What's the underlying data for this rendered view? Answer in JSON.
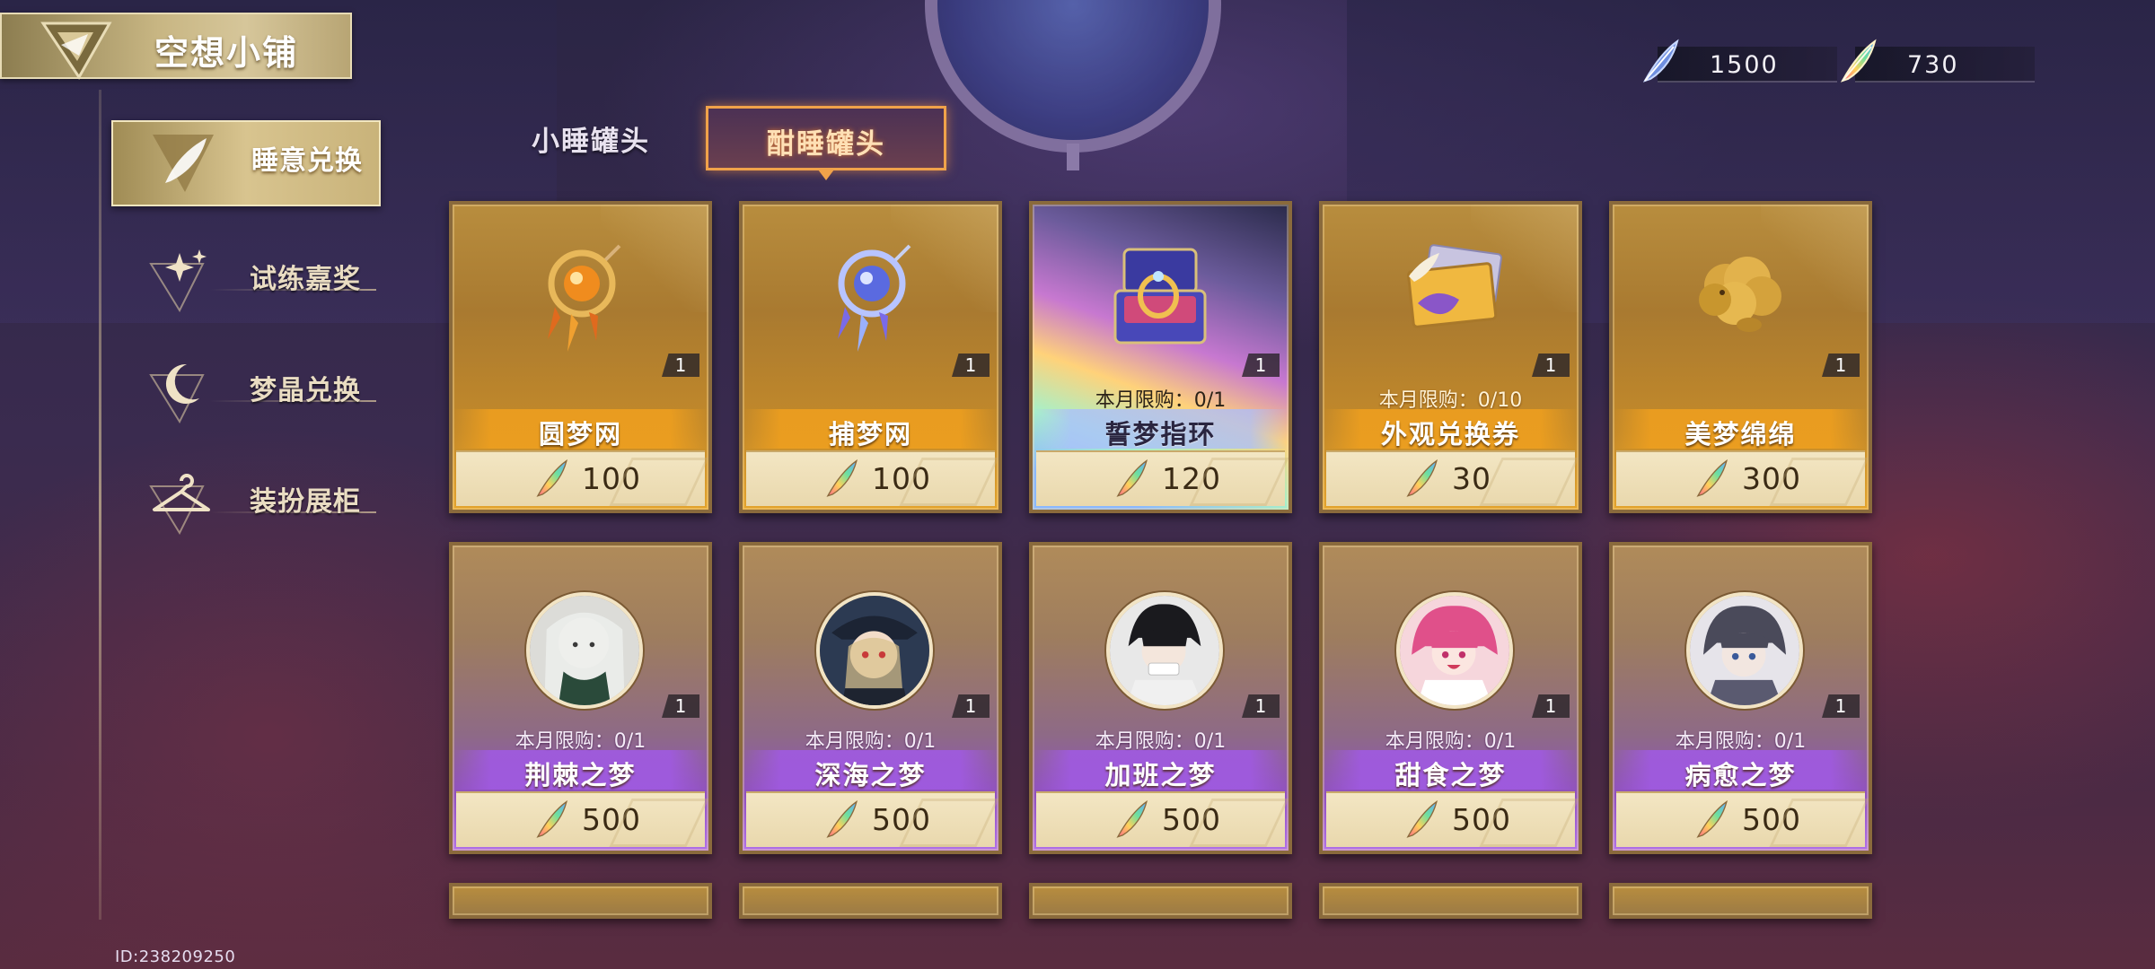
{
  "header": {
    "title": "空想小铺"
  },
  "currency": [
    {
      "icon": "blue-feather-icon",
      "value": "1500"
    },
    {
      "icon": "rainbow-feather-icon",
      "value": "730"
    }
  ],
  "sidebar": {
    "items": [
      {
        "label": "睡意兑换",
        "active": true
      },
      {
        "label": "试练嘉奖",
        "active": false
      },
      {
        "label": "梦晶兑换",
        "active": false
      },
      {
        "label": "装扮展柜",
        "active": false
      }
    ]
  },
  "tabs": [
    {
      "label": "小睡罐头",
      "active": false
    },
    {
      "label": "酣睡罐头",
      "active": true
    }
  ],
  "shop": {
    "items": [
      {
        "name": "圆梦网",
        "qty": "1",
        "limit": "",
        "price": "100",
        "style": "gold",
        "art": "gold-dreamcatcher"
      },
      {
        "name": "捕梦网",
        "qty": "1",
        "limit": "",
        "price": "100",
        "style": "gold",
        "art": "blue-dreamcatcher"
      },
      {
        "name": "誓梦指环",
        "qty": "1",
        "limit": "本月限购：0/1",
        "price": "120",
        "style": "rainbow",
        "art": "ring-box"
      },
      {
        "name": "外观兑换券",
        "qty": "1",
        "limit": "本月限购：0/10",
        "price": "30",
        "style": "gold",
        "art": "costume-voucher"
      },
      {
        "name": "美梦绵绵",
        "qty": "1",
        "limit": "",
        "price": "300",
        "style": "gold",
        "art": "golden-sheep"
      },
      {
        "name": "荆棘之梦",
        "qty": "1",
        "limit": "本月限购：0/1",
        "price": "500",
        "style": "purple",
        "art": "portrait-white-hair"
      },
      {
        "name": "深海之梦",
        "qty": "1",
        "limit": "本月限购：0/1",
        "price": "500",
        "style": "purple",
        "art": "portrait-captain"
      },
      {
        "name": "加班之梦",
        "qty": "1",
        "limit": "本月限购：0/1",
        "price": "500",
        "style": "purple",
        "art": "portrait-dark-hair"
      },
      {
        "name": "甜食之梦",
        "qty": "1",
        "limit": "本月限购：0/1",
        "price": "500",
        "style": "purple",
        "art": "portrait-pink-hair"
      },
      {
        "name": "病愈之梦",
        "qty": "1",
        "limit": "本月限购：0/1",
        "price": "500",
        "style": "purple",
        "art": "portrait-grey-hair"
      }
    ]
  },
  "footer": {
    "player_id": "ID:238209250"
  },
  "colors": {
    "tab_active_border": "#f0a24a",
    "gold_band": "#f0a01e",
    "purple_band": "#a05ae1",
    "price_bar": "#f3e6c3"
  }
}
